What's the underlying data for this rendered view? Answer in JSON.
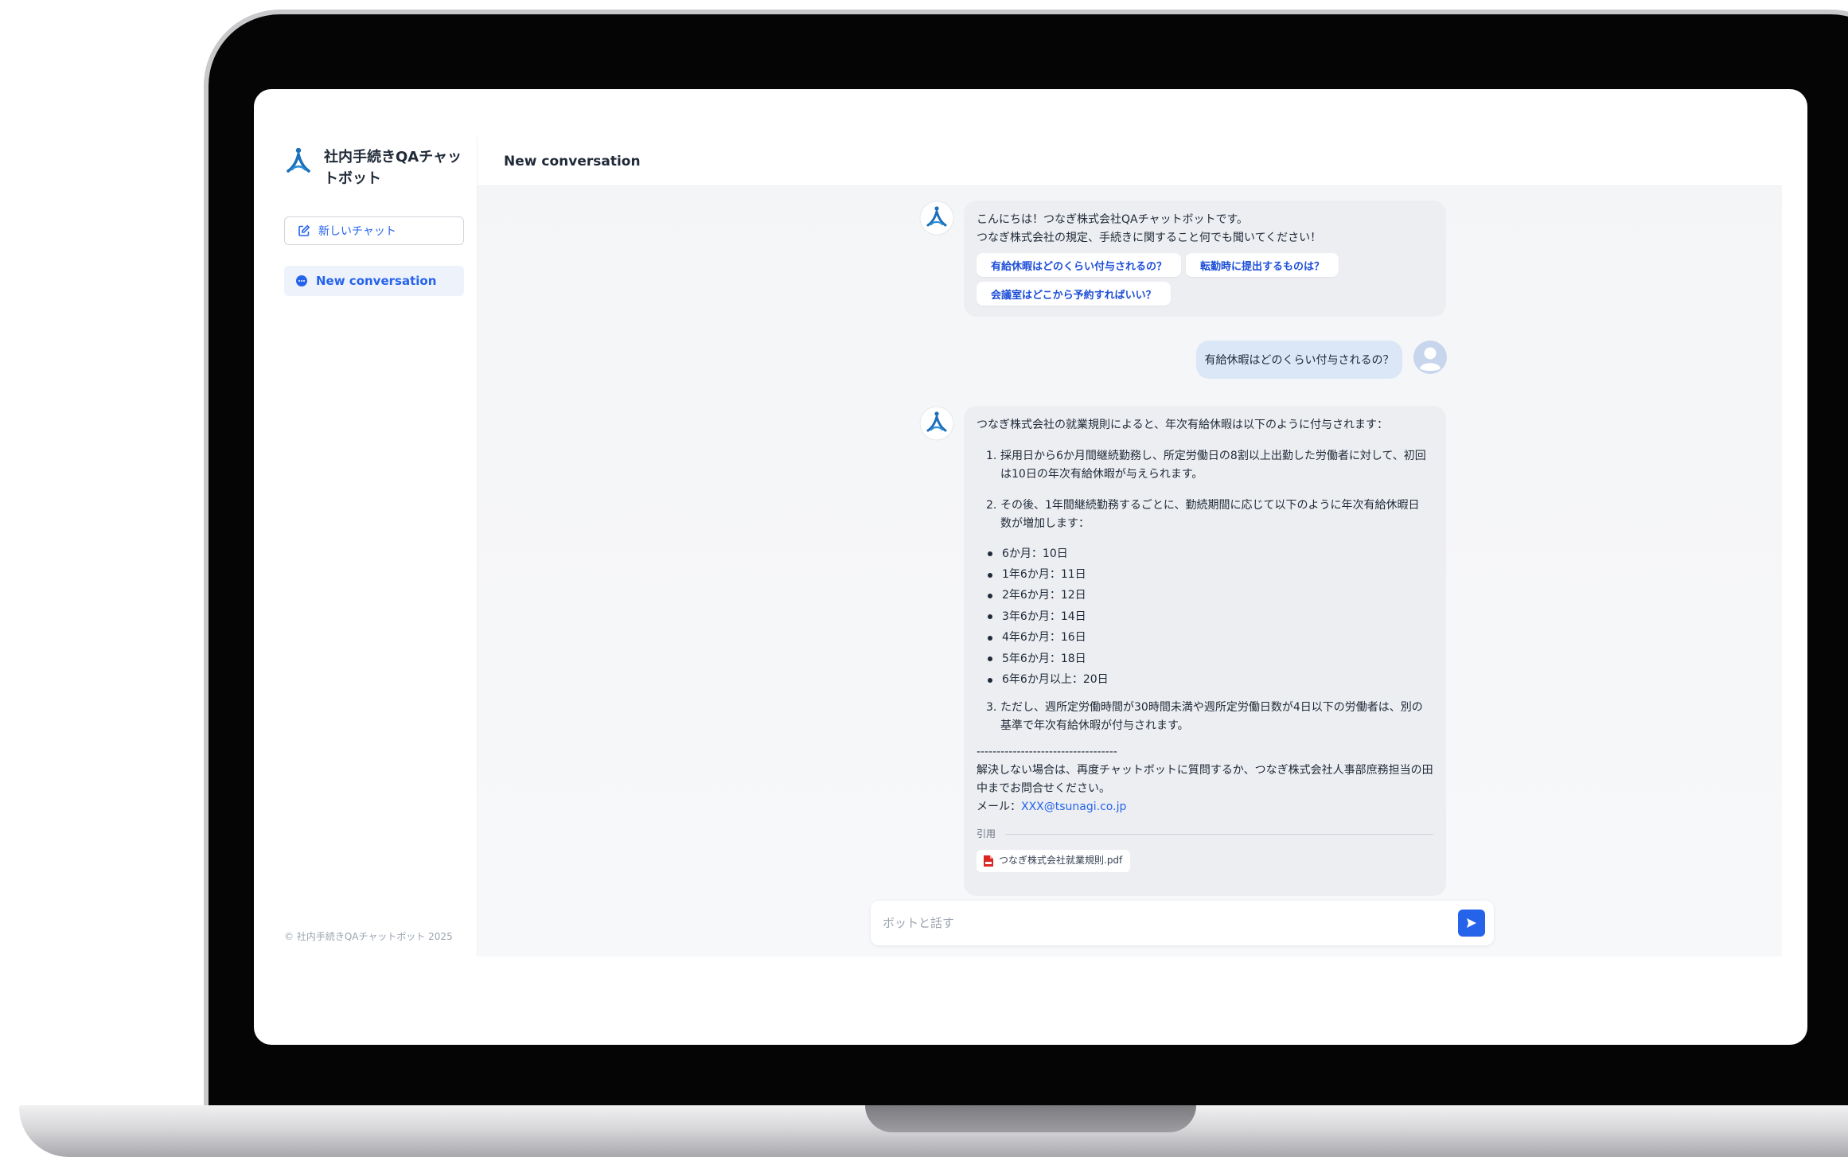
{
  "app": {
    "brand_title": "社内手続きQAチャットボット",
    "copyright": "© 社内手続きQAチャットボット 2025"
  },
  "sidebar": {
    "new_chat_label": "新しいチャット",
    "conversations": [
      {
        "label": "New conversation"
      }
    ]
  },
  "header": {
    "title": "New conversation"
  },
  "messages": {
    "greeting": {
      "line1": "こんにちは！つなぎ株式会社QAチャットボットです。",
      "line2": "つなぎ株式会社の規定、手続きに関すること何でも聞いてください！",
      "suggestions": [
        "有給休暇はどのくらい付与されるの？",
        "転勤時に提出するものは？",
        "会議室はどこから予約すればいい？"
      ]
    },
    "user_question": "有給休暇はどのくらい付与されるの？",
    "answer": {
      "intro": "つなぎ株式会社の就業規則によると、年次有給休暇は以下のように付与されます：",
      "item1_num": "1.",
      "item1": "採用日から6か月間継続勤務し、所定労働日の8割以上出勤した労働者に対して、初回は10日の年次有給休暇が与えられます。",
      "item2_num": "2.",
      "item2": "その後、1年間継続勤務するごとに、勤続期間に応じて以下のように年次有給休暇日数が増加します：",
      "bullets": [
        "6か月：10日",
        "1年6か月：11日",
        "2年6か月：12日",
        "3年6か月：14日",
        "4年6か月：16日",
        "5年6か月：18日",
        "6年6か月以上：20日"
      ],
      "item3_num": "3.",
      "item3": "ただし、週所定労働時間が30時間未満や週所定労働日数が4日以下の労働者は、別の基準で年次有給休暇が付与されます。",
      "divider": "-----------------------------------",
      "footer1": "解決しない場合は、再度チャットボットに質問するか、つなぎ株式会社人事部庶務担当の田中までお問合せください。",
      "mail_label": "メール：",
      "mail_address": "XXX@tsunagi.co.jp",
      "citation_label": "引用",
      "citation_file": "つなぎ株式会社就業規則.pdf"
    }
  },
  "composer": {
    "placeholder": "ボットと話す"
  },
  "colors": {
    "accent": "#2563eb",
    "bubble_bot": "#eceef2",
    "bubble_user": "#dbe7f7",
    "logo": "#1c6fb8"
  },
  "icons": {
    "brand": "tsunagi-logo-icon",
    "new_chat": "edit-icon",
    "conversation": "chat-bubble-icon",
    "user": "user-avatar-icon",
    "pdf": "pdf-file-icon",
    "send": "send-icon"
  }
}
